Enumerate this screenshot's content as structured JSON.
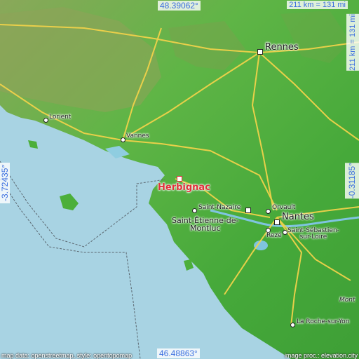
{
  "map": {
    "coords": {
      "top": "48.39062°",
      "bottom": "46.48863°",
      "left": "-3.72435°",
      "right": "-0.31185°"
    },
    "scale": {
      "top": "211 km = 131 mi",
      "side": "211 km = 131 mi"
    },
    "primary_place": "Herbignac",
    "places": {
      "rennes": "Rennes",
      "lorient": "Lorient",
      "vannes": "Vannes",
      "saint_nazaire": "Saint-Nazaire",
      "saint_etienne": "Saint-Étienne-de-\nMontluc",
      "orvault": "Orvault",
      "nantes": "Nantes",
      "reze": "Rezé",
      "saint_sebastien": "Saint-Sébastien-\nsur-Loire",
      "la_roche": "La Roche-sur-Yon",
      "mont": "Mont"
    },
    "credits": {
      "left": "map data: openstreetmap, style: opentopomap",
      "right": "image proc.: elevation.city"
    },
    "colors": {
      "sea": "#a8d3e3",
      "lowland": "#4caf3a",
      "highland": "#7ea34b",
      "road": "#f0d24a",
      "primary": "#e0313b"
    }
  }
}
